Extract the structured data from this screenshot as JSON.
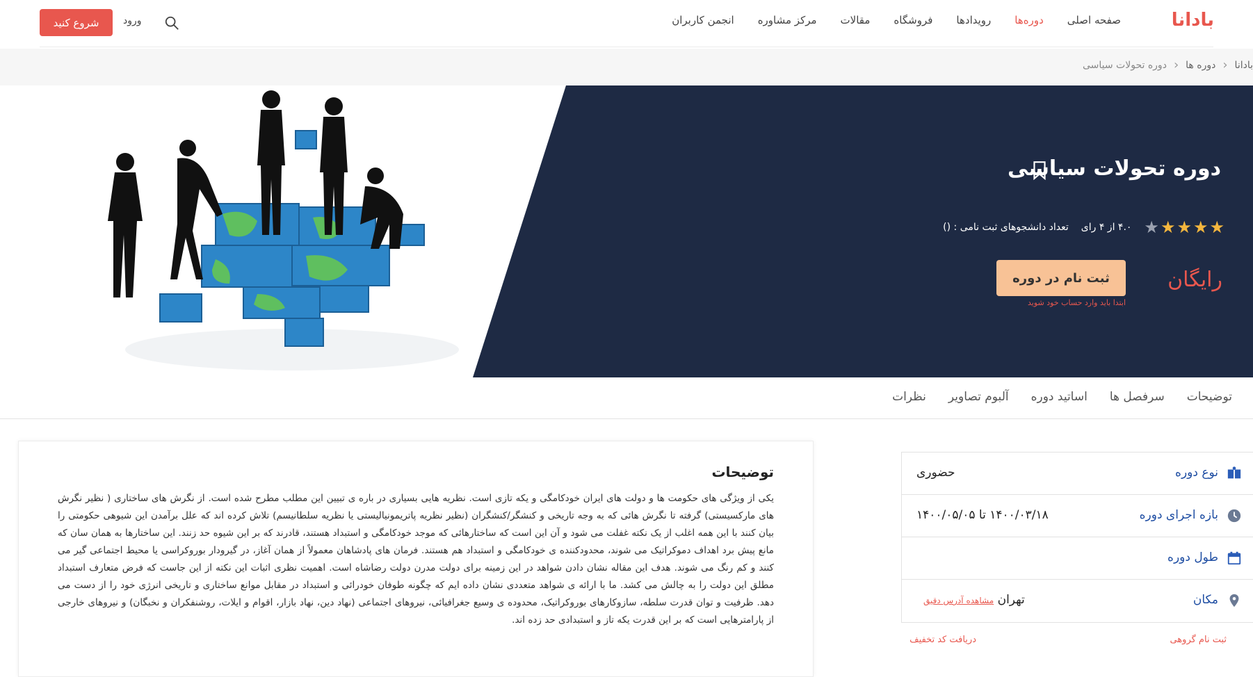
{
  "header": {
    "logo": "بادانا",
    "nav": [
      "صفحه اصلی",
      "دوره‌ها",
      "رویدادها",
      "فروشگاه",
      "مقالات",
      "مرکز مشاوره",
      "انجمن کاربران"
    ],
    "login": "ورود",
    "start": "شروع کنید"
  },
  "breadcrumb": [
    "بادانا",
    "دوره ها",
    "دوره تحولات سیاسی"
  ],
  "hero": {
    "title": "دوره تحولات سیاسی",
    "rating_text": "۴.۰ از ۴ رای",
    "rating_value": 4,
    "rating_max": 5,
    "students": "تعداد دانشجوهای ثبت نامی : ()",
    "price": "رایگان",
    "enroll": "ثبت نام در دوره",
    "enroll_note": "ابتدا باید وارد حساب خود شوید"
  },
  "tabs": [
    "توضیحات",
    "سرفصل ها",
    "اساتید دوره",
    "آلبوم تصاویر",
    "نظرات"
  ],
  "description": {
    "title": "توضیحات",
    "text": "یکی از ویژگی های حکومت ها و دولت های ایران خودکامگی و یکه تازی است. نظریه هایی بسیاری در باره ی تبیین این مطلب مطرح شده است. از نگرش های ساختاری ( نظیر نگرش های مارکسیستی) گرفته تا نگرش هائی که به وجه تاریخی و کنشگر/کنشگران (نظیر نظریه پاتریمونیالیستی یا نظریه سلطانیسم) تلاش کرده اند که علل برآمدن این شیوهی حکومتی را بیان کنند با این همه اغلب از یک نکته غفلت می شود و آن این است که ساختارهائی که موجد خودکامگی و استبداد هستند، قادرند که بر این شیوه حد زنند. این ساختارها به همان سان که مانع پیش برد اهداف دموکراتیک می شوند، محدودکننده ی خودکامگی و استبداد هم هستند. فرمان های پادشاهان معمولاً از همان آغاز، در گیرودار بوروکراسی یا محیط اجتماعی گیر می کنند و کم رنگ می شوند. هدف این مقاله نشان دادن شواهد در این زمینه برای دولت مدرن دولت رضاشاه است. اهمیت نظری اثبات این نکته از این جاست که فرض متعارف استبداد مطلق این دولت را به چالش می کشد. ما با ارائه ی شواهد متعددی نشان داده ایم که چگونه طوفان خودرائی و استبداد در مقابل موانع ساختاری و تاریخی انرژی خود را از دست می دهد. ظرفیت و توان قدرت سلطه، سازوکارهای بوروکراتیک، محدوده ی وسیع جغرافیائی، نیروهای اجتماعی (نهاد دین، نهاد بازار، اقوام و ایلات، روشنفکران و نخبگان) و نیروهای خارجی از پارامترهایی است که بر این قدرت یکه تاز و استبدادی حد زده اند."
  },
  "info": [
    {
      "label": "نوع دوره",
      "value": "حضوری",
      "icon": "book-icon"
    },
    {
      "label": "بازه اجرای دوره",
      "value": "۱۴۰۰/۰۳/۱۸ تا ۱۴۰۰/۰۵/۰۵",
      "icon": "clock-icon"
    },
    {
      "label": "طول دوره",
      "value": "",
      "icon": "calendar-icon"
    },
    {
      "label": "مکان",
      "value": "تهران",
      "link": "مشاهده آدرس دقیق",
      "icon": "location-icon"
    }
  ],
  "links": {
    "group": "ثبت نام گروهی",
    "discount": "دریافت کد تخفیف"
  },
  "colors": {
    "accent": "#e8574e",
    "hero_bg": "#1e2a44",
    "link_blue": "#1f4ea3",
    "enroll_bg": "#f8c296"
  }
}
